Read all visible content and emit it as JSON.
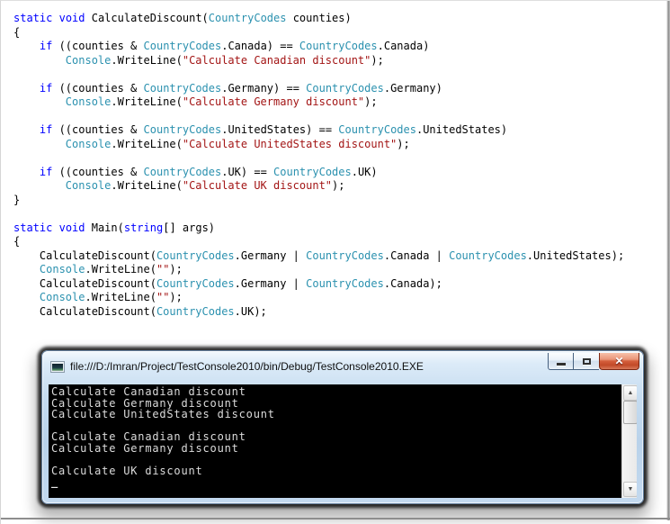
{
  "code": {
    "token_colors": {
      "keyword": "#0000ff",
      "type": "#2b91af",
      "string": "#a31515",
      "plain": "#000000"
    },
    "lines": [
      [
        [
          "keyword",
          "static"
        ],
        [
          "plain",
          " "
        ],
        [
          "keyword",
          "void"
        ],
        [
          "plain",
          " CalculateDiscount("
        ],
        [
          "type",
          "CountryCodes"
        ],
        [
          "plain",
          " counties)"
        ]
      ],
      [
        [
          "plain",
          "{"
        ]
      ],
      [
        [
          "plain",
          "    "
        ],
        [
          "keyword",
          "if"
        ],
        [
          "plain",
          " ((counties & "
        ],
        [
          "type",
          "CountryCodes"
        ],
        [
          "plain",
          ".Canada) == "
        ],
        [
          "type",
          "CountryCodes"
        ],
        [
          "plain",
          ".Canada)"
        ]
      ],
      [
        [
          "plain",
          "        "
        ],
        [
          "type",
          "Console"
        ],
        [
          "plain",
          ".WriteLine("
        ],
        [
          "string",
          "\"Calculate Canadian discount\""
        ],
        [
          "plain",
          ");"
        ]
      ],
      [],
      [
        [
          "plain",
          "    "
        ],
        [
          "keyword",
          "if"
        ],
        [
          "plain",
          " ((counties & "
        ],
        [
          "type",
          "CountryCodes"
        ],
        [
          "plain",
          ".Germany) == "
        ],
        [
          "type",
          "CountryCodes"
        ],
        [
          "plain",
          ".Germany)"
        ]
      ],
      [
        [
          "plain",
          "        "
        ],
        [
          "type",
          "Console"
        ],
        [
          "plain",
          ".WriteLine("
        ],
        [
          "string",
          "\"Calculate Germany discount\""
        ],
        [
          "plain",
          ");"
        ]
      ],
      [],
      [
        [
          "plain",
          "    "
        ],
        [
          "keyword",
          "if"
        ],
        [
          "plain",
          " ((counties & "
        ],
        [
          "type",
          "CountryCodes"
        ],
        [
          "plain",
          ".UnitedStates) == "
        ],
        [
          "type",
          "CountryCodes"
        ],
        [
          "plain",
          ".UnitedStates)"
        ]
      ],
      [
        [
          "plain",
          "        "
        ],
        [
          "type",
          "Console"
        ],
        [
          "plain",
          ".WriteLine("
        ],
        [
          "string",
          "\"Calculate UnitedStates discount\""
        ],
        [
          "plain",
          ");"
        ]
      ],
      [],
      [
        [
          "plain",
          "    "
        ],
        [
          "keyword",
          "if"
        ],
        [
          "plain",
          " ((counties & "
        ],
        [
          "type",
          "CountryCodes"
        ],
        [
          "plain",
          ".UK) == "
        ],
        [
          "type",
          "CountryCodes"
        ],
        [
          "plain",
          ".UK)"
        ]
      ],
      [
        [
          "plain",
          "        "
        ],
        [
          "type",
          "Console"
        ],
        [
          "plain",
          ".WriteLine("
        ],
        [
          "string",
          "\"Calculate UK discount\""
        ],
        [
          "plain",
          ");"
        ]
      ],
      [
        [
          "plain",
          "}"
        ]
      ],
      [],
      [
        [
          "keyword",
          "static"
        ],
        [
          "plain",
          " "
        ],
        [
          "keyword",
          "void"
        ],
        [
          "plain",
          " Main("
        ],
        [
          "keyword",
          "string"
        ],
        [
          "plain",
          "[] args)"
        ]
      ],
      [
        [
          "plain",
          "{"
        ]
      ],
      [
        [
          "plain",
          "    CalculateDiscount("
        ],
        [
          "type",
          "CountryCodes"
        ],
        [
          "plain",
          ".Germany | "
        ],
        [
          "type",
          "CountryCodes"
        ],
        [
          "plain",
          ".Canada | "
        ],
        [
          "type",
          "CountryCodes"
        ],
        [
          "plain",
          ".UnitedStates);"
        ]
      ],
      [
        [
          "plain",
          "    "
        ],
        [
          "type",
          "Console"
        ],
        [
          "plain",
          ".WriteLine("
        ],
        [
          "string",
          "\"\""
        ],
        [
          "plain",
          ");"
        ]
      ],
      [
        [
          "plain",
          "    CalculateDiscount("
        ],
        [
          "type",
          "CountryCodes"
        ],
        [
          "plain",
          ".Germany | "
        ],
        [
          "type",
          "CountryCodes"
        ],
        [
          "plain",
          ".Canada);"
        ]
      ],
      [
        [
          "plain",
          "    "
        ],
        [
          "type",
          "Console"
        ],
        [
          "plain",
          ".WriteLine("
        ],
        [
          "string",
          "\"\""
        ],
        [
          "plain",
          ");"
        ]
      ],
      [
        [
          "plain",
          "    CalculateDiscount("
        ],
        [
          "type",
          "CountryCodes"
        ],
        [
          "plain",
          ".UK);"
        ]
      ]
    ]
  },
  "console_window": {
    "title": "file:///D:/Imran/Project/TestConsole2010/bin/Debug/TestConsole2010.EXE",
    "output_lines": [
      "Calculate Canadian discount",
      "Calculate Germany discount",
      "Calculate UnitedStates discount",
      "",
      "Calculate Canadian discount",
      "Calculate Germany discount",
      "",
      "Calculate UK discount"
    ],
    "cursor": "_",
    "icons": {
      "app": "console-app-icon",
      "close": "✕",
      "scroll_up": "▲",
      "scroll_down": "▼"
    },
    "colors": {
      "console_background": "#000000",
      "console_text": "#dcdcdc",
      "close_button": "#c24a28",
      "frame": "#c6dcf0"
    }
  }
}
